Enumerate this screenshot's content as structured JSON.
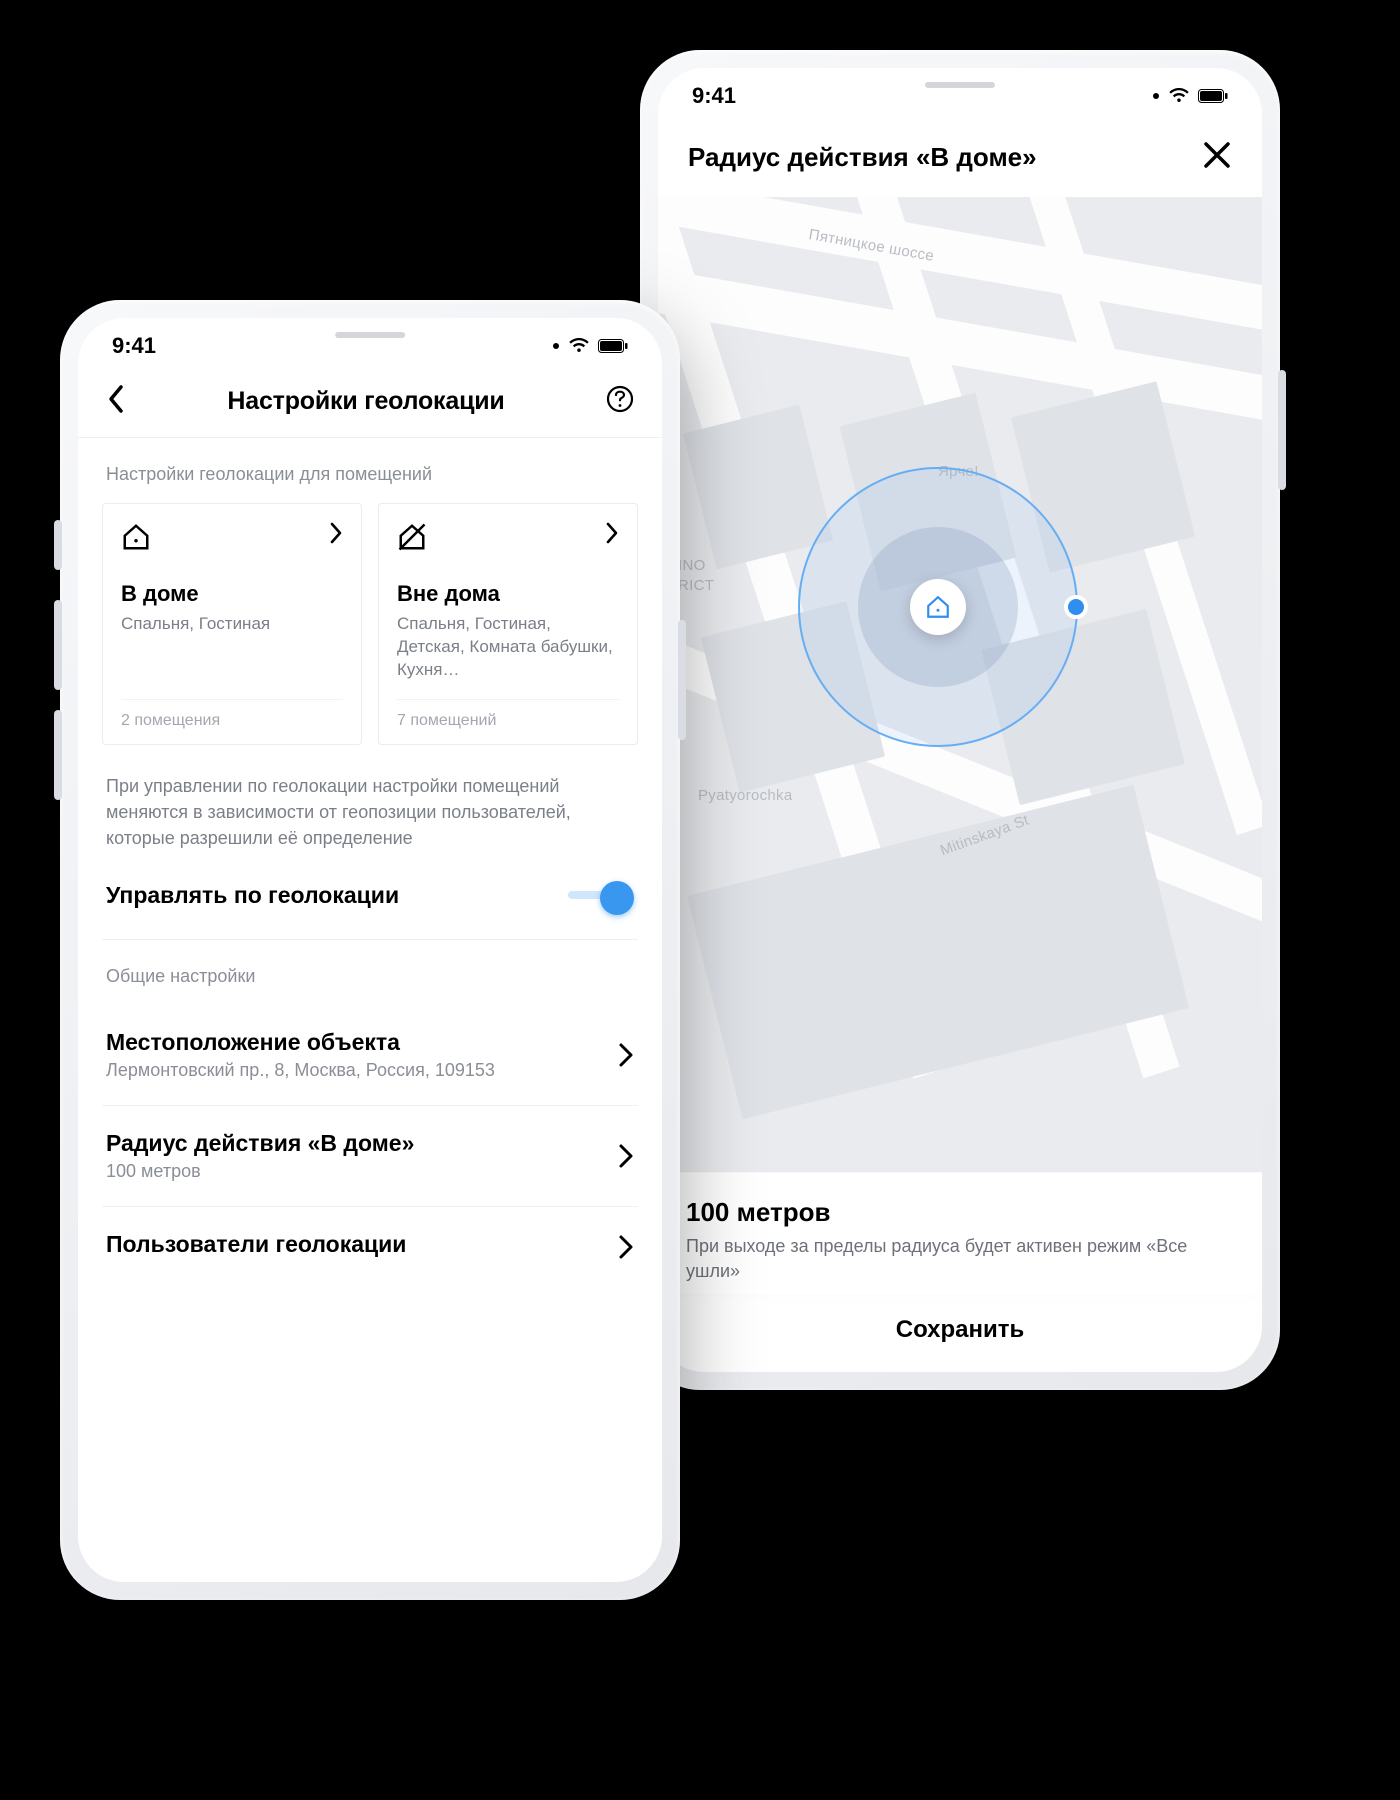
{
  "status": {
    "time": "9:41"
  },
  "left": {
    "nav_title": "Настройки геолокации",
    "section_caption": "Настройки геолокации для помещений",
    "card_home": {
      "title": "В доме",
      "subtitle": "Спальня, Гостиная",
      "footer": "2 помещения"
    },
    "card_away": {
      "title": "Вне дома",
      "subtitle": "Спальня, Гостиная, Детская, Комната бабушки, Кухня…",
      "footer": "7 помещений"
    },
    "description": "При управлении по геолокации настройки помещений меняются в зависимости от геопозиции пользователей, которые разрешили её определение",
    "toggle_label": "Управлять по геолокации",
    "toggle_on": true,
    "general_caption": "Общие настройки",
    "row_location": {
      "title": "Местоположение объекта",
      "subtitle": "Лермонтовский пр., 8, Москва, Россия, 109153"
    },
    "row_radius": {
      "title": "Радиус действия «В доме»",
      "subtitle": "100 метров"
    },
    "row_users": {
      "title": "Пользователи геолокации"
    }
  },
  "right": {
    "title": "Радиус действия «В доме»",
    "map_labels": {
      "road_top": "Пятницкое шоссе",
      "poi_top": "Ярче!",
      "district1": "INO",
      "district2": "RICT",
      "poi_bottom": "Pyatyorochka",
      "street": "Mitinskaya St"
    },
    "panel_title": "100 метров",
    "panel_sub": "При выходе за пределы радиуса будет активен режим «Все ушли»",
    "save": "Сохранить"
  }
}
